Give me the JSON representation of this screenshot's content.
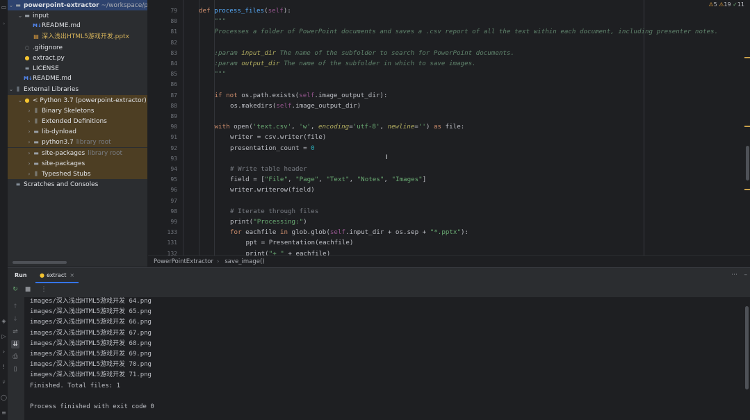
{
  "project": {
    "root_name": "powerpoint-extractor",
    "root_path": "~/workspace/pyth",
    "items": [
      {
        "label": "input",
        "icon": "folder-icon",
        "depth": 1,
        "arrow": "⌄",
        "kind": "folder"
      },
      {
        "label": "README.md",
        "icon": "markdown-icon",
        "depth": 2,
        "arrow": "",
        "kind": "md"
      },
      {
        "label": "深入浅出HTML5游戏开发.pptx",
        "icon": "pptx-icon",
        "depth": 2,
        "arrow": "",
        "kind": "ppt"
      },
      {
        "label": ".gitignore",
        "icon": "gitignore-icon",
        "depth": 1,
        "arrow": "",
        "kind": "git"
      },
      {
        "label": "extract.py",
        "icon": "python-file-icon",
        "depth": 1,
        "arrow": "",
        "kind": "py"
      },
      {
        "label": "LICENSE",
        "icon": "text-file-icon",
        "depth": 1,
        "arrow": "",
        "kind": "txt"
      },
      {
        "label": "README.md",
        "icon": "markdown-icon",
        "depth": 1,
        "arrow": "",
        "kind": "md"
      },
      {
        "label": "External Libraries",
        "icon": "library-icon",
        "depth": 0,
        "arrow": "⌄",
        "kind": "lib"
      },
      {
        "label": "< Python 3.7 (powerpoint-extractor) >",
        "icon": "python-sdk-icon",
        "depth": 1,
        "arrow": "⌄",
        "kind": "py"
      },
      {
        "label": "Binary Skeletons",
        "icon": "library-icon",
        "depth": 2,
        "arrow": "›",
        "kind": "lib"
      },
      {
        "label": "Extended Definitions",
        "icon": "library-icon",
        "depth": 2,
        "arrow": "›",
        "kind": "lib"
      },
      {
        "label": "lib-dynload",
        "icon": "folder-icon",
        "depth": 2,
        "arrow": "›",
        "kind": "folder"
      },
      {
        "label": "python3.7",
        "icon": "folder-icon",
        "depth": 2,
        "arrow": "›",
        "kind": "folder",
        "hint": "library root"
      },
      {
        "label": "site-packages",
        "icon": "folder-icon",
        "depth": 2,
        "arrow": "›",
        "kind": "folder",
        "hint": "library root"
      },
      {
        "label": "site-packages",
        "icon": "folder-icon",
        "depth": 2,
        "arrow": "›",
        "kind": "folder"
      },
      {
        "label": "Typeshed Stubs",
        "icon": "library-icon",
        "depth": 2,
        "arrow": "›",
        "kind": "lib"
      },
      {
        "label": "Scratches and Consoles",
        "icon": "scratches-icon",
        "depth": 0,
        "arrow": "",
        "kind": "txt"
      }
    ]
  },
  "editor": {
    "inspection": {
      "warnings": "5",
      "weak": "19",
      "typos": "11"
    },
    "lines": [
      {
        "n": "79",
        "html": "<span class=\"kw\">def</span> <span class=\"fn\">process_files</span>(<span class=\"self\">self</span>):",
        "indent": 1
      },
      {
        "n": "80",
        "html": "<span class=\"doc\">\"\"\"</span>",
        "indent": 2
      },
      {
        "n": "81",
        "html": "<span class=\"doc\">Processes a folder of PowerPoint documents and saves a .csv report of all the text within each document, including presenter notes.</span>",
        "indent": 2
      },
      {
        "n": "82",
        "html": "",
        "indent": 2
      },
      {
        "n": "83",
        "html": "<span class=\"doc\">:param <span class=\"param\">input_dir</span> The name of the subfolder to search for PowerPoint documents.</span>",
        "indent": 2
      },
      {
        "n": "84",
        "html": "<span class=\"doc\">:param <span class=\"param\">output_dir</span> The name of the subfolder in which to save images.</span>",
        "indent": 2
      },
      {
        "n": "85",
        "html": "<span class=\"doc\">\"\"\"</span>",
        "indent": 2
      },
      {
        "n": "86",
        "html": "",
        "indent": 2
      },
      {
        "n": "87",
        "html": "<span class=\"kw\">if not</span> os.path.exists(<span class=\"self\">self</span>.image_output_dir):",
        "indent": 2
      },
      {
        "n": "88",
        "html": "os.makedirs(<span class=\"self\">self</span>.image_output_dir)",
        "indent": 3
      },
      {
        "n": "89",
        "html": "",
        "indent": 2
      },
      {
        "n": "90",
        "html": "<span class=\"kw\">with</span> open(<span class=\"str\">'text.csv'</span>, <span class=\"str\">'w'</span>, <span class=\"param\">encoding</span>=<span class=\"str\">'utf-8'</span>, <span class=\"param\">newline</span>=<span class=\"str\">''</span>) <span class=\"kw\">as</span> file:",
        "indent": 2
      },
      {
        "n": "91",
        "html": "writer = csv.writer(file)",
        "indent": 3
      },
      {
        "n": "92",
        "html": "presentation_count = <span class=\"num\">0</span>",
        "indent": 3
      },
      {
        "n": "93",
        "html": "",
        "indent": 3
      },
      {
        "n": "94",
        "html": "<span class=\"cmt\"># Write table header</span>",
        "indent": 3
      },
      {
        "n": "95",
        "html": "field = [<span class=\"str\">\"File\"</span>, <span class=\"str\">\"Page\"</span>, <span class=\"str\">\"Text\"</span>, <span class=\"str\">\"Notes\"</span>, <span class=\"str\">\"Images\"</span>]",
        "indent": 3
      },
      {
        "n": "96",
        "html": "writer.writerow(field)",
        "indent": 3
      },
      {
        "n": "97",
        "html": "",
        "indent": 3
      },
      {
        "n": "98",
        "html": "<span class=\"cmt\"># Iterate through files</span>",
        "indent": 3
      },
      {
        "n": "99",
        "html": "print(<span class=\"str\">\"Processing:\"</span>)",
        "indent": 3
      },
      {
        "n": "133",
        "html": "<span class=\"kw\">for</span> eachfile <span class=\"kw\">in</span> glob.glob(<span class=\"self\">self</span>.input_dir + os.sep + <span class=\"str\">\"*.pptx\"</span>):",
        "indent": 3
      },
      {
        "n": "131",
        "html": "ppt = Presentation(eachfile)",
        "indent": 4
      },
      {
        "n": "132",
        "html": "print(<span class=\"str\">\"+ \"</span> + eachfile)",
        "indent": 4
      }
    ]
  },
  "breadcrumb": {
    "class_name": "PowerPointExtractor",
    "sep": "›",
    "method": "save_image()"
  },
  "run": {
    "title": "Run",
    "tab_label": "extract",
    "console": [
      "images/深入浅出HTML5游戏开发 64.png",
      "images/深入浅出HTML5游戏开发 65.png",
      "images/深入浅出HTML5游戏开发 66.png",
      "images/深入浅出HTML5游戏开发 67.png",
      "images/深入浅出HTML5游戏开发 68.png",
      "images/深入浅出HTML5游戏开发 69.png",
      "images/深入浅出HTML5游戏开发 70.png",
      "images/深入浅出HTML5游戏开发 71.png",
      "Finished. Total files: 1",
      "",
      "Process finished with exit code 0"
    ]
  }
}
